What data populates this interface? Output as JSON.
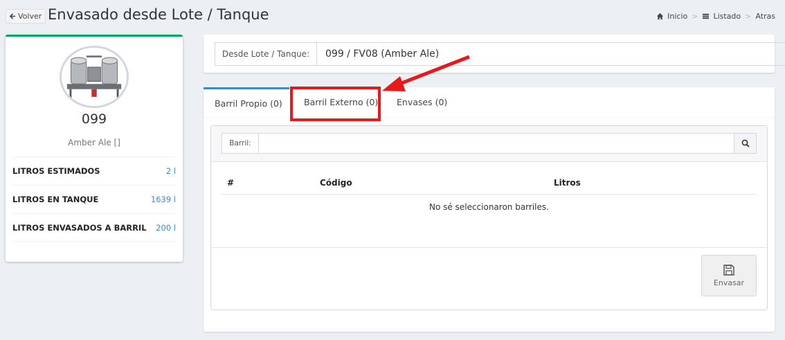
{
  "header": {
    "back_label": "Volver",
    "title": "Envasado desde Lote / Tanque",
    "breadcrumb": [
      "Inicio",
      "Listado",
      "Atras"
    ]
  },
  "lot": {
    "number": "099",
    "beer": "Amber Ale []",
    "stats": [
      {
        "label": "LITROS ESTIMADOS",
        "value": "2 l"
      },
      {
        "label": "LITROS EN TANQUE",
        "value": "1639 l"
      },
      {
        "label": "LITROS ENVASADOS A BARRIL",
        "value": "200 l"
      }
    ]
  },
  "source": {
    "label": "Desde Lote / Tanque:",
    "value": "099 / FV08 (Amber Ale)"
  },
  "tabs": [
    {
      "label": "Barril Propio (0)",
      "active": true
    },
    {
      "label": "Barril Externo (0)",
      "active": false,
      "highlighted": true
    },
    {
      "label": "Envases (0)",
      "active": false
    }
  ],
  "barril": {
    "label": "Barril:",
    "value": ""
  },
  "table": {
    "columns": [
      "#",
      "Código",
      "Litros"
    ],
    "empty_message": "No sé seleccionaron barriles."
  },
  "actions": {
    "save_label": "Envasar"
  },
  "colors": {
    "accent": "#3c8dbc",
    "success": "#00a65a",
    "annotation": "#e8191b"
  }
}
